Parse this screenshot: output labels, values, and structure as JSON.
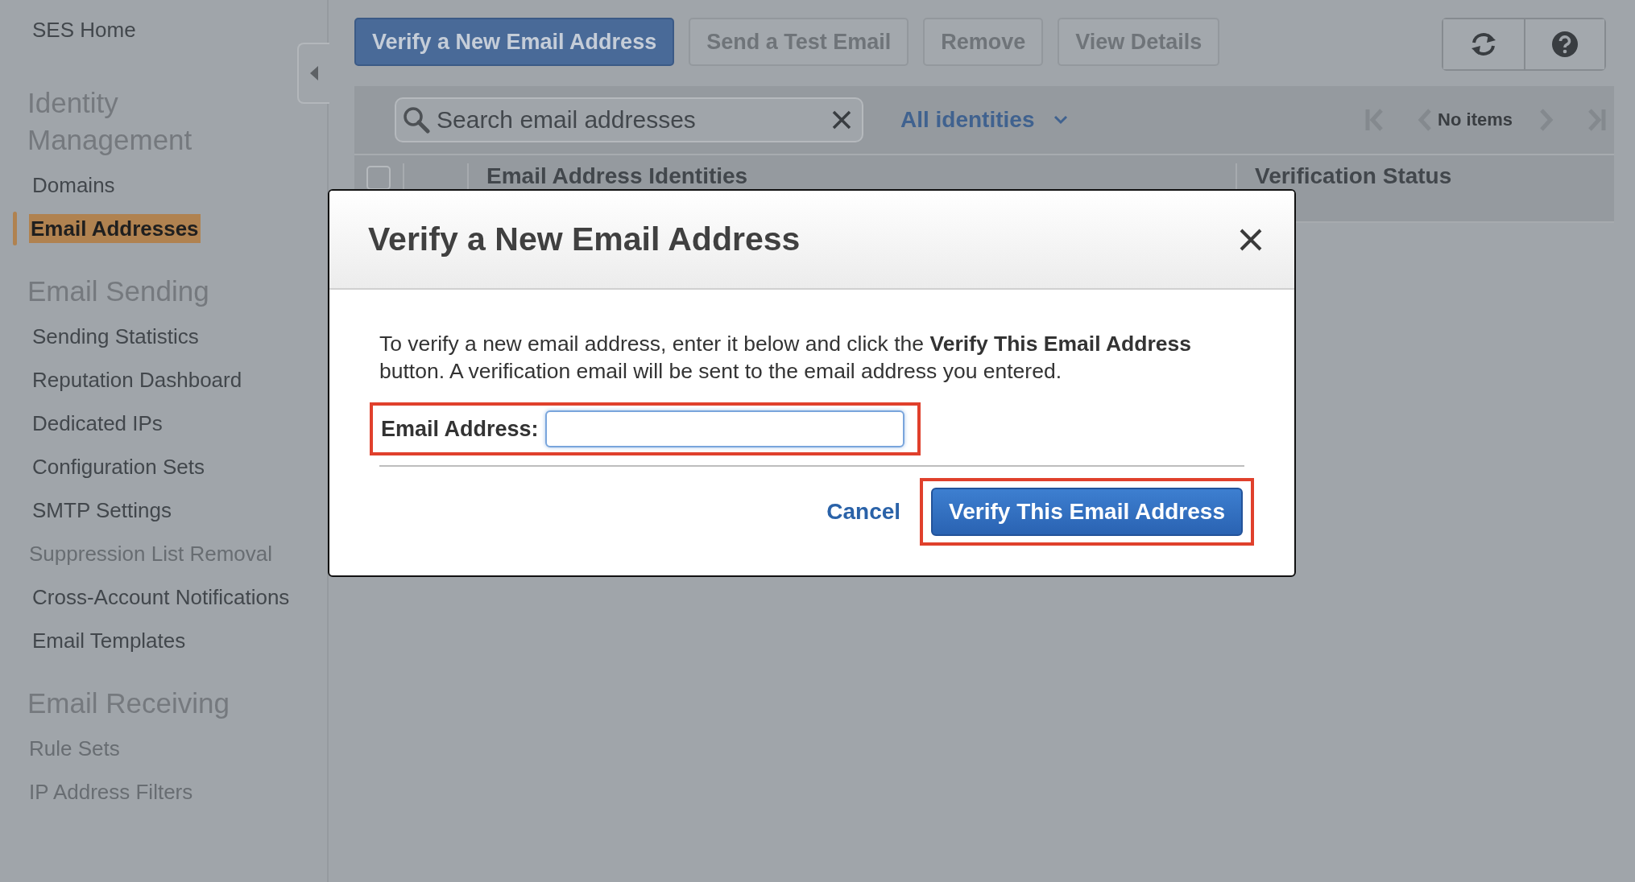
{
  "sidebar": {
    "home": "SES Home",
    "sections": [
      {
        "title": "Identity Management",
        "items": [
          {
            "label": "Domains",
            "selected": false,
            "disabled": false
          },
          {
            "label": "Email Addresses",
            "selected": true,
            "disabled": false
          }
        ]
      },
      {
        "title": "Email Sending",
        "items": [
          {
            "label": "Sending Statistics",
            "selected": false,
            "disabled": false
          },
          {
            "label": "Reputation Dashboard",
            "selected": false,
            "disabled": false
          },
          {
            "label": "Dedicated IPs",
            "selected": false,
            "disabled": false
          },
          {
            "label": "Configuration Sets",
            "selected": false,
            "disabled": false
          },
          {
            "label": "SMTP Settings",
            "selected": false,
            "disabled": false
          },
          {
            "label": "Suppression List Removal",
            "selected": false,
            "disabled": true
          },
          {
            "label": "Cross-Account Notifications",
            "selected": false,
            "disabled": false
          },
          {
            "label": "Email Templates",
            "selected": false,
            "disabled": false
          }
        ]
      },
      {
        "title": "Email Receiving",
        "items": [
          {
            "label": "Rule Sets",
            "selected": false,
            "disabled": true
          },
          {
            "label": "IP Address Filters",
            "selected": false,
            "disabled": true
          }
        ]
      }
    ]
  },
  "toolbar": {
    "buttons": [
      {
        "label": "Verify a New Email Address",
        "kind": "primary",
        "disabled": false
      },
      {
        "label": "Send a Test Email",
        "kind": "secondary",
        "disabled": true
      },
      {
        "label": "Remove",
        "kind": "secondary",
        "disabled": true
      },
      {
        "label": "View Details",
        "kind": "secondary",
        "disabled": true
      }
    ]
  },
  "filter_bar": {
    "search_placeholder": "Search email addresses",
    "filter": "All identities",
    "pager": "No items"
  },
  "table": {
    "select_all_checked": false,
    "columns": [
      "Email Address Identities",
      "Verification Status"
    ]
  },
  "dialog": {
    "title": "Verify a New Email Address",
    "intro": "To verify a new email address, enter it below and click the **Verify This Email Address** button. A verification email will be sent to the email address you entered.",
    "field_label": "Email Address:",
    "field_highlighted": true,
    "cancel": "Cancel",
    "confirm": "Verify This Email Address",
    "confirm_highlighted": true
  }
}
